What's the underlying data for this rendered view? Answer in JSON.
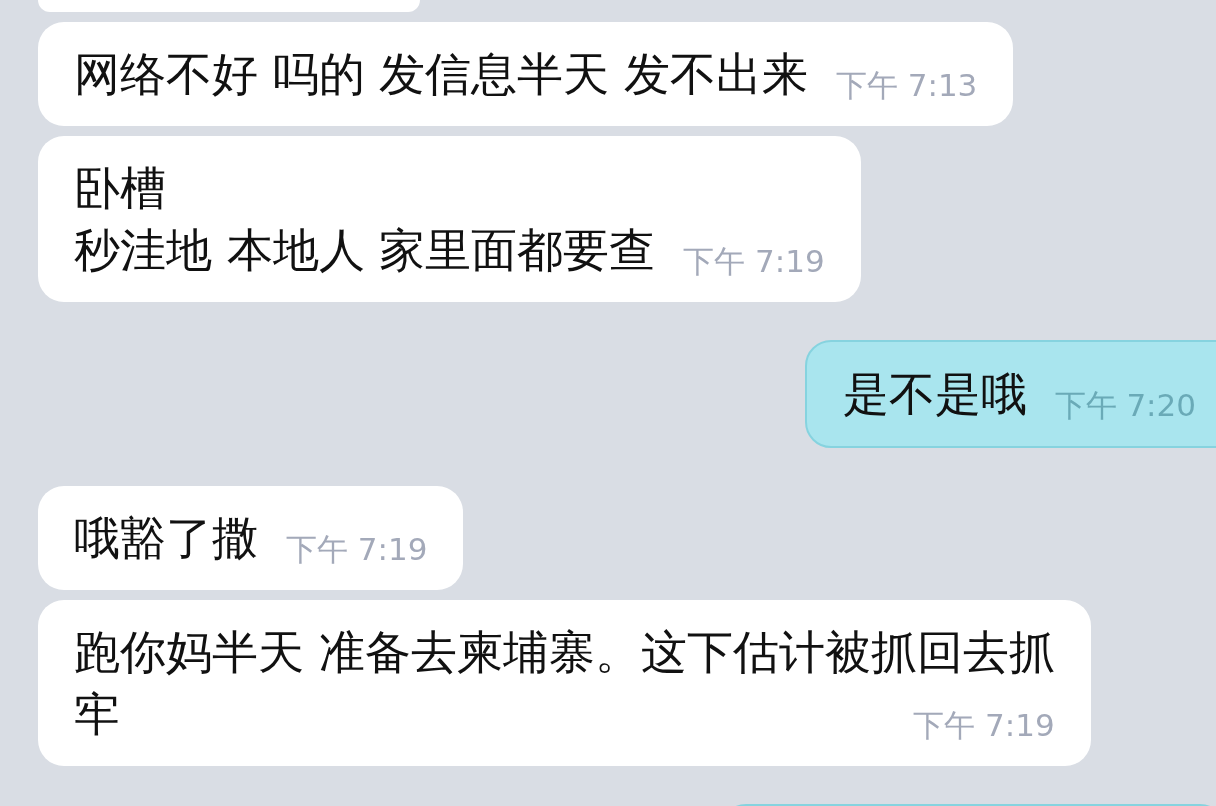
{
  "messages": [
    {
      "kind": "incoming",
      "lines": [
        "网络不好 吗的 发信息半天 发不出来"
      ],
      "time": "下午 7:13"
    },
    {
      "kind": "incoming",
      "lines": [
        "卧槽",
        "秒洼地 本地人 家里面都要查"
      ],
      "time": "下午 7:19"
    },
    {
      "kind": "outgoing",
      "lines": [
        "是不是哦"
      ],
      "time": "下午 7:20"
    },
    {
      "kind": "incoming",
      "lines": [
        "哦豁了撒"
      ],
      "time": "下午 7:19"
    },
    {
      "kind": "incoming",
      "lines": [
        "跑你妈半天 准备去柬埔寨。这下估计被抓回去抓",
        "牢"
      ],
      "time": "下午 7:19"
    }
  ]
}
